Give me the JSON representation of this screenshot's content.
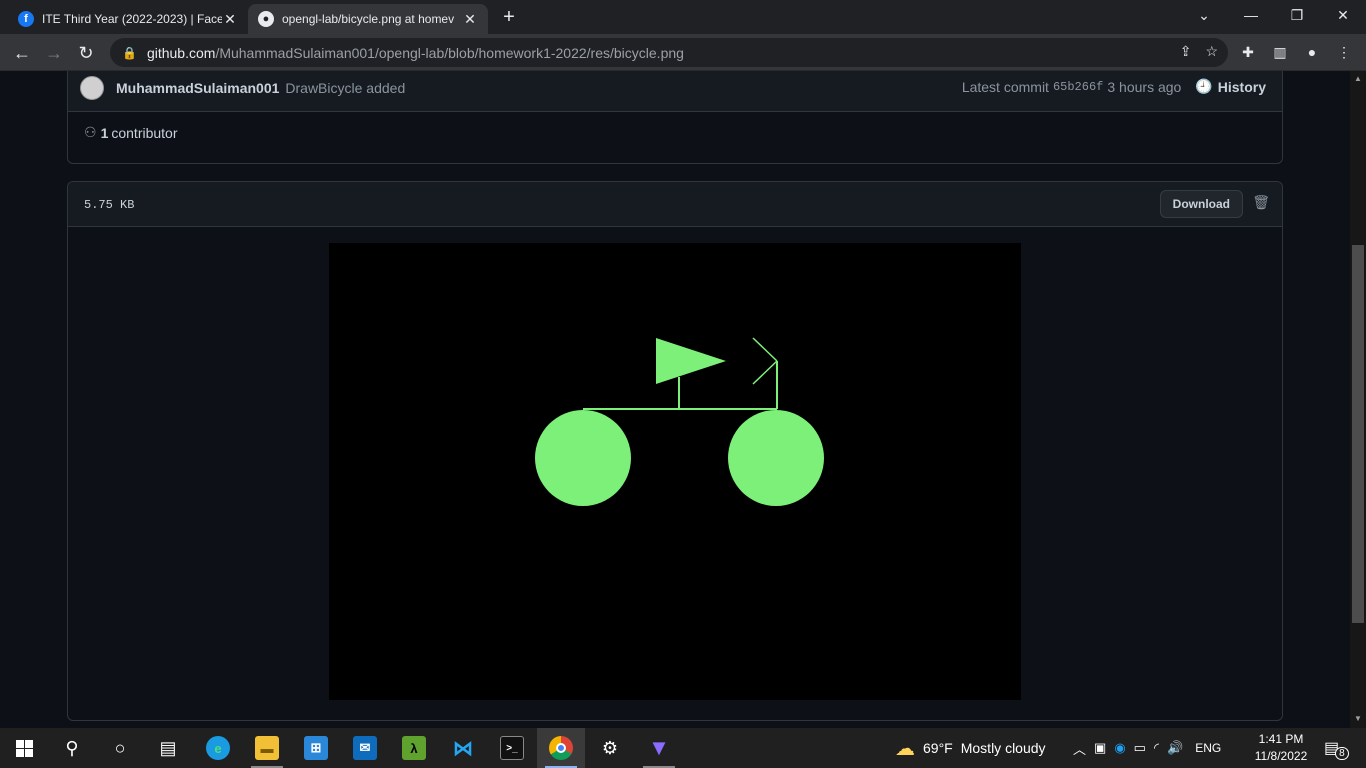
{
  "browser": {
    "tabs": [
      {
        "title": "ITE Third Year (2022-2023) | Facel",
        "favicon": "facebook-icon",
        "active": false
      },
      {
        "title": "opengl-lab/bicycle.png at homev",
        "favicon": "github-icon",
        "active": true
      }
    ],
    "url_host": "github.com",
    "url_path": "/MuhammadSulaiman001/opengl-lab/blob/homework1-2022/res/bicycle.png"
  },
  "commit": {
    "author": "MuhammadSulaiman001",
    "message": "DrawBicycle added",
    "latest_label": "Latest commit",
    "sha": "65b266f",
    "time": "3 hours ago",
    "history_label": "History"
  },
  "contributors": {
    "count": "1",
    "label": "contributor"
  },
  "file": {
    "size": "5.75 KB",
    "download_label": "Download"
  },
  "image": {
    "background": "#000000",
    "shape_color": "#7df07a"
  },
  "taskbar": {
    "weather_temp": "69°F",
    "weather_desc": "Mostly cloudy",
    "lang": "ENG",
    "time": "1:41 PM",
    "date": "11/8/2022",
    "notifications": "8"
  },
  "colors": {
    "page_bg": "#0d1117",
    "border": "#30363d",
    "text": "#c9d1d9",
    "muted": "#8b949e"
  }
}
